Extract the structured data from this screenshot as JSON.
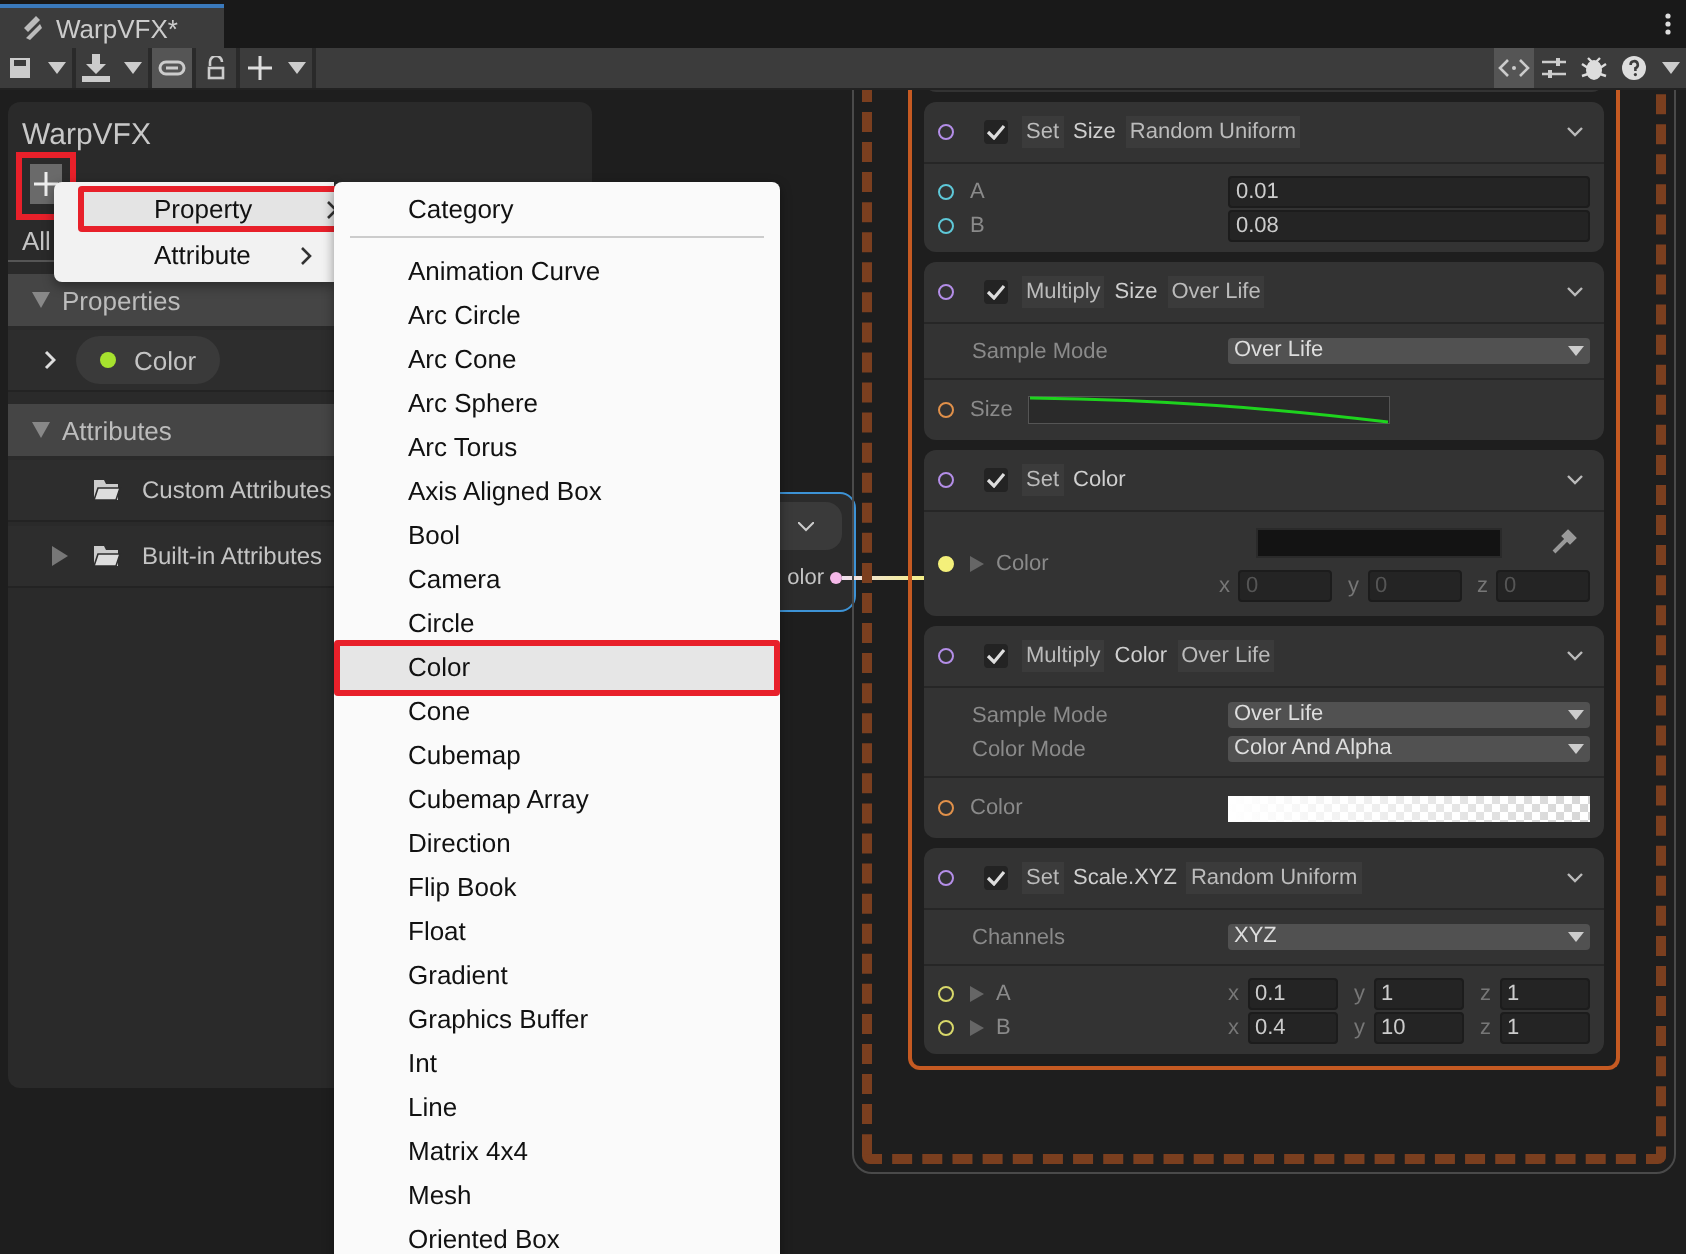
{
  "tab": {
    "title": "WarpVFX*"
  },
  "toolbar": {
    "left": [
      {
        "kind": "save",
        "dropdown": true,
        "selected": false
      },
      {
        "kind": "import",
        "dropdown": true,
        "selected": false
      },
      {
        "kind": "link",
        "dropdown": false,
        "selected": true
      },
      {
        "kind": "lock",
        "dropdown": false,
        "selected": false
      },
      {
        "kind": "add",
        "dropdown": true,
        "selected": false
      }
    ],
    "right": [
      {
        "kind": "code",
        "dropdown": false,
        "selected": true
      },
      {
        "kind": "sliders",
        "dropdown": false,
        "selected": false
      },
      {
        "kind": "bug",
        "dropdown": false,
        "selected": false
      },
      {
        "kind": "help",
        "dropdown": true,
        "selected": false
      }
    ]
  },
  "blackboard": {
    "title": "WarpVFX",
    "add_annotated": true,
    "filter_tab": "All",
    "sections": [
      {
        "title": "Properties",
        "expanded": true,
        "items": [
          {
            "kind": "property",
            "label": "Color",
            "color": "#a6e22e",
            "expander": true
          }
        ]
      },
      {
        "title": "Attributes",
        "expanded": true,
        "items": [
          {
            "kind": "folder",
            "label": "Custom Attributes",
            "expander": false
          },
          {
            "kind": "folder",
            "label": "Built-in Attributes",
            "expander": true
          }
        ]
      }
    ]
  },
  "partial_node": {
    "port_label": "olor"
  },
  "context": {
    "blocks": [
      {
        "verb": "Set",
        "attribute": "Size",
        "mode": "Random Uniform",
        "enabled": true,
        "sections": [
          [
            {
              "kind": "float",
              "label": "A",
              "color": "#5ec8d8",
              "value": "0.01"
            },
            {
              "kind": "float",
              "label": "B",
              "color": "#5ec8d8",
              "value": "0.08"
            }
          ]
        ]
      },
      {
        "verb": "Multiply",
        "attribute": "Size",
        "mode": "Over Life",
        "enabled": true,
        "sections": [
          [
            {
              "kind": "dropdown",
              "label": "Sample Mode",
              "value": "Over Life"
            }
          ],
          [
            {
              "kind": "curve",
              "label": "Size",
              "color": "#e0904a"
            }
          ]
        ]
      },
      {
        "verb": "Set",
        "attribute": "Color",
        "enabled": true,
        "sections": [
          [
            {
              "kind": "color",
              "label": "Color",
              "color": "#f4f07a",
              "connected": true,
              "components": [
                {
                  "axis": "x",
                  "placeholder": "0"
                },
                {
                  "axis": "y",
                  "placeholder": "0"
                },
                {
                  "axis": "z",
                  "placeholder": "0"
                }
              ]
            }
          ]
        ]
      },
      {
        "verb": "Multiply",
        "attribute": "Color",
        "mode": "Over Life",
        "enabled": true,
        "sections": [
          [
            {
              "kind": "dropdown",
              "label": "Sample Mode",
              "value": "Over Life"
            },
            {
              "kind": "dropdown",
              "label": "Color Mode",
              "value": "Color And Alpha"
            }
          ],
          [
            {
              "kind": "gradient",
              "label": "Color",
              "color": "#e0904a"
            }
          ]
        ]
      },
      {
        "verb": "Set",
        "attribute": "Scale.XYZ",
        "mode": "Random Uniform",
        "enabled": true,
        "sections": [
          [
            {
              "kind": "dropdown",
              "label": "Channels",
              "value": "XYZ"
            }
          ],
          [
            {
              "kind": "vector",
              "label": "A",
              "color": "#d8d86a",
              "components": [
                {
                  "axis": "x",
                  "value": "0.1"
                },
                {
                  "axis": "y",
                  "value": "1"
                },
                {
                  "axis": "z",
                  "value": "1"
                }
              ]
            },
            {
              "kind": "vector",
              "label": "B",
              "color": "#d8d86a",
              "components": [
                {
                  "axis": "x",
                  "value": "0.4"
                },
                {
                  "axis": "y",
                  "value": "10"
                },
                {
                  "axis": "z",
                  "value": "1"
                }
              ]
            }
          ]
        ]
      }
    ]
  },
  "menu": {
    "items": [
      {
        "label": "Property",
        "selected": true,
        "annotated": true
      },
      {
        "label": "Attribute",
        "selected": false,
        "annotated": false
      }
    ]
  },
  "submenu": {
    "header": "Category",
    "items": [
      {
        "label": "Animation Curve",
        "selected": false,
        "annotated": false
      },
      {
        "label": "Arc Circle",
        "selected": false,
        "annotated": false
      },
      {
        "label": "Arc Cone",
        "selected": false,
        "annotated": false
      },
      {
        "label": "Arc Sphere",
        "selected": false,
        "annotated": false
      },
      {
        "label": "Arc Torus",
        "selected": false,
        "annotated": false
      },
      {
        "label": "Axis Aligned Box",
        "selected": false,
        "annotated": false
      },
      {
        "label": "Bool",
        "selected": false,
        "annotated": false
      },
      {
        "label": "Camera",
        "selected": false,
        "annotated": false
      },
      {
        "label": "Circle",
        "selected": false,
        "annotated": false
      },
      {
        "label": "Color",
        "selected": true,
        "annotated": true
      },
      {
        "label": "Cone",
        "selected": false,
        "annotated": false
      },
      {
        "label": "Cubemap",
        "selected": false,
        "annotated": false
      },
      {
        "label": "Cubemap Array",
        "selected": false,
        "annotated": false
      },
      {
        "label": "Direction",
        "selected": false,
        "annotated": false
      },
      {
        "label": "Flip Book",
        "selected": false,
        "annotated": false
      },
      {
        "label": "Float",
        "selected": false,
        "annotated": false
      },
      {
        "label": "Gradient",
        "selected": false,
        "annotated": false
      },
      {
        "label": "Graphics Buffer",
        "selected": false,
        "annotated": false
      },
      {
        "label": "Int",
        "selected": false,
        "annotated": false
      },
      {
        "label": "Line",
        "selected": false,
        "annotated": false
      },
      {
        "label": "Matrix 4x4",
        "selected": false,
        "annotated": false
      },
      {
        "label": "Mesh",
        "selected": false,
        "annotated": false
      },
      {
        "label": "Oriented Box",
        "selected": false,
        "annotated": false
      }
    ]
  }
}
